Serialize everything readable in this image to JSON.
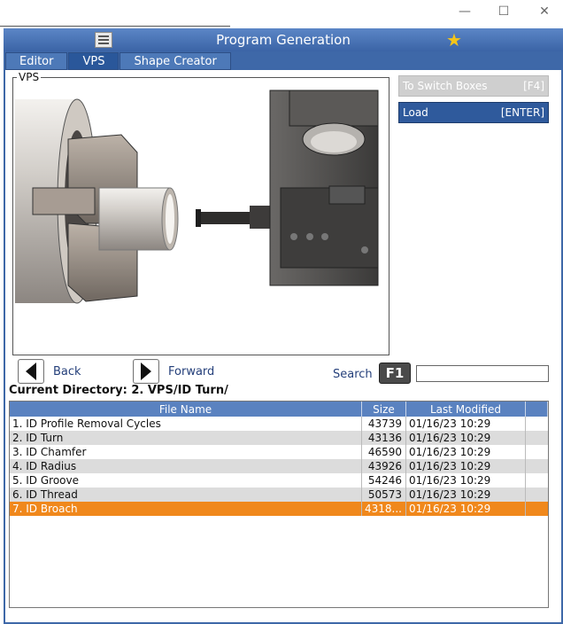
{
  "window": {
    "minimize_glyph": "—",
    "maximize_glyph": "☐",
    "close_glyph": "✕"
  },
  "app": {
    "title": "Program Generation",
    "icons": [
      "menu-icon",
      "star-icon"
    ],
    "accent": "#3e68a8"
  },
  "tabs": [
    {
      "label": "Editor"
    },
    {
      "label": "VPS",
      "active": true
    },
    {
      "label": "Shape Creator"
    }
  ],
  "vps": {
    "label": "VPS"
  },
  "side_buttons": {
    "switch_label": "To Switch Boxes",
    "switch_key": "[F4]",
    "load_label": "Load",
    "load_key": "[ENTER]"
  },
  "nav": {
    "back_label": "Back",
    "forward_label": "Forward",
    "search_label": "Search",
    "search_key": "F1",
    "search_value": ""
  },
  "current_directory": "Current Directory: 2. VPS/ID Turn/",
  "table": {
    "headers": {
      "name": "File Name",
      "size": "Size",
      "modified": "Last Modified"
    },
    "rows": [
      {
        "name": "1. ID Profile Removal Cycles",
        "size": "43739",
        "modified": "01/16/23 10:29"
      },
      {
        "name": "2. ID Turn",
        "size": "43136",
        "modified": "01/16/23 10:29"
      },
      {
        "name": "3. ID Chamfer",
        "size": "46590",
        "modified": "01/16/23 10:29"
      },
      {
        "name": "4. ID Radius",
        "size": "43926",
        "modified": "01/16/23 10:29"
      },
      {
        "name": "5. ID Groove",
        "size": "54246",
        "modified": "01/16/23 10:29"
      },
      {
        "name": "6. ID Thread",
        "size": "50573",
        "modified": "01/16/23 10:29"
      },
      {
        "name": "7. ID Broach",
        "size": "4318...",
        "modified": "01/16/23 10:29",
        "selected": true
      }
    ],
    "selected_color": "#f0881c"
  }
}
